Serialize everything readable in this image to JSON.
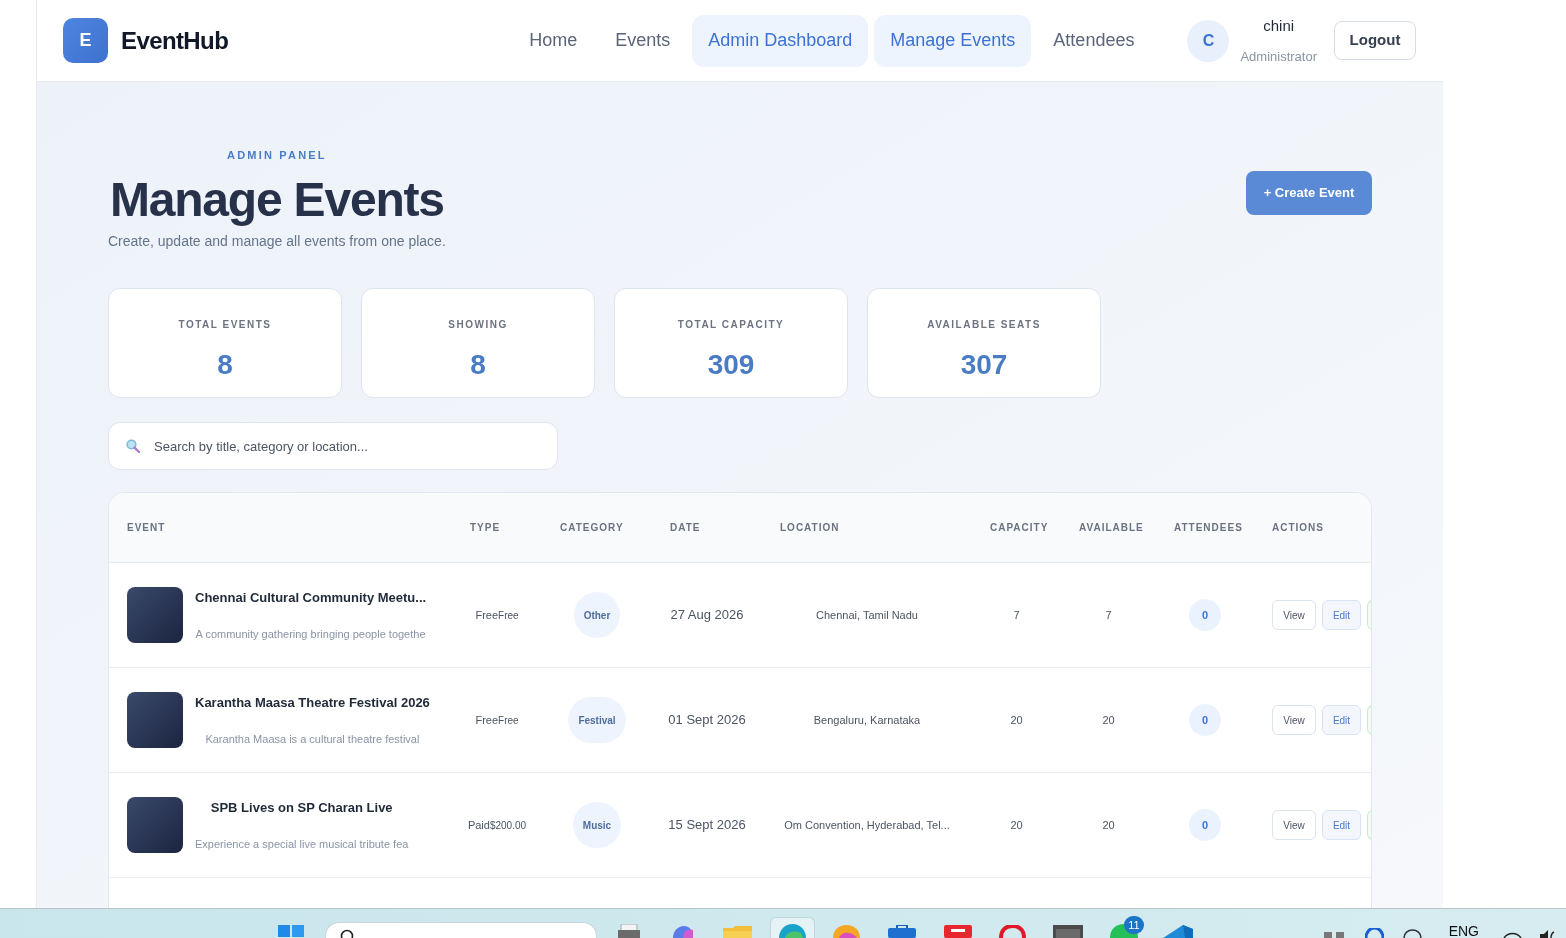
{
  "brand": {
    "logo_letter": "E",
    "name": "EventHub"
  },
  "nav": [
    {
      "label": "Home",
      "selected": false
    },
    {
      "label": "Events",
      "selected": false
    },
    {
      "label": "Admin Dashboard",
      "selected": true
    },
    {
      "label": "Manage Events",
      "selected": true
    },
    {
      "label": "Attendees",
      "selected": false
    }
  ],
  "user": {
    "initial": "C",
    "name": "chini",
    "role": "Administrator"
  },
  "logout": "Logout",
  "page": {
    "eyebrow": "ADMIN PANEL",
    "title": "Manage Events",
    "subtitle": "Create, update and manage all events from one place.",
    "create_button": "+ Create Event"
  },
  "stats": [
    {
      "label": "TOTAL EVENTS",
      "value": "8"
    },
    {
      "label": "SHOWING",
      "value": "8"
    },
    {
      "label": "TOTAL CAPACITY",
      "value": "309"
    },
    {
      "label": "AVAILABLE SEATS",
      "value": "307"
    }
  ],
  "search": {
    "placeholder": "Search by title, category or location..."
  },
  "table": {
    "columns": [
      "EVENT",
      "TYPE",
      "CATEGORY",
      "DATE",
      "LOCATION",
      "CAPACITY",
      "AVAILABLE",
      "ATTENDEES",
      "ACTIONS"
    ],
    "rows": [
      {
        "title": "Chennai Cultural Community Meetu...",
        "description": "A community gathering bringing people togethe",
        "type": "Free",
        "price": "Free",
        "category": "Other",
        "date": "27 Aug 2026",
        "location": "Chennai, Tamil Nadu",
        "capacity": "7",
        "available": "7",
        "attendees": "0",
        "actions": [
          {
            "kind": "view",
            "label": "View"
          },
          {
            "kind": "edit",
            "label": "Edit"
          }
        ]
      },
      {
        "title": "Karantha Maasa Theatre Festival 2026",
        "description": "Karantha Maasa is a cultural theatre festival",
        "type": "Free",
        "price": "Free",
        "category": "Festival",
        "date": "01 Sept 2026",
        "location": "Bengaluru, Karnataka",
        "capacity": "20",
        "available": "20",
        "attendees": "0",
        "actions": [
          {
            "kind": "view",
            "label": "View"
          },
          {
            "kind": "edit",
            "label": "Edit"
          }
        ]
      },
      {
        "title": "SPB Lives on SP Charan Live",
        "description": "Experience a special live musical tribute fea",
        "type": "Paid",
        "price": "$200.00",
        "category": "Music",
        "date": "15 Sept 2026",
        "location": "Om Convention, Hyderabad, Tel...",
        "capacity": "20",
        "available": "20",
        "attendees": "0",
        "actions": [
          {
            "kind": "view",
            "label": "View"
          },
          {
            "kind": "edit",
            "label": "Edit"
          }
        ]
      }
    ]
  },
  "taskbar": {
    "badge": "11",
    "language": "ENG"
  }
}
